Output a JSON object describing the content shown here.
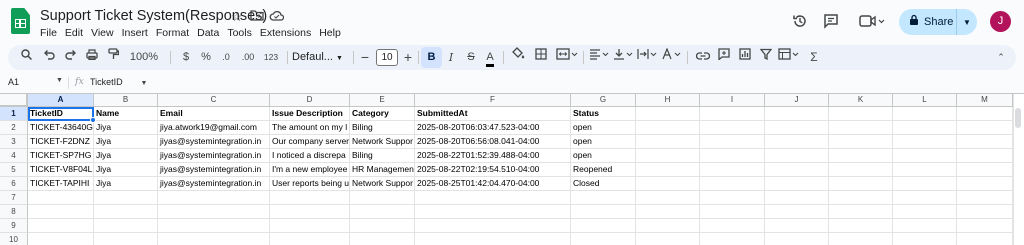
{
  "window": {
    "title": "Support Ticket System(Responses)",
    "menus": [
      "File",
      "Edit",
      "View",
      "Insert",
      "Format",
      "Data",
      "Tools",
      "Extensions",
      "Help"
    ],
    "share_label": "Share",
    "avatar_initial": "J"
  },
  "toolbar": {
    "zoom": "100%",
    "currency_symbol": "$",
    "percent_symbol": "%",
    "decrease_decimal": ".0",
    "increase_decimal": ".00",
    "number_format": "123",
    "font_family": "Defaul...",
    "font_size": "10",
    "bold": "B",
    "italic": "I",
    "text_color": "A"
  },
  "formula_bar": {
    "cell_ref": "A1",
    "fx": "fx",
    "content": "TicketID"
  },
  "sheet": {
    "columns": [
      "A",
      "B",
      "C",
      "D",
      "E",
      "F",
      "G",
      "H",
      "I",
      "J",
      "K",
      "L",
      "M"
    ],
    "row_numbers": [
      "1",
      "2",
      "3",
      "4",
      "5",
      "6",
      "7",
      "8",
      "9",
      "10"
    ],
    "headers": [
      "TicketID",
      "Name",
      "Email",
      "Issue Description",
      "Category",
      "SubmittedAt",
      "Status"
    ],
    "rows": [
      [
        "TICKET-43640G",
        "Jiya",
        "jiya.atwork19@gmail.com",
        "The amount on my l",
        "Biling",
        "2025-08-20T06:03:47.523-04:00",
        "open"
      ],
      [
        "TICKET-F2DNZ",
        "Jiya",
        "jiyas@systemintegration.in",
        "Our company server",
        "Network Suppor",
        "2025-08-20T06:56:08.041-04:00",
        "open"
      ],
      [
        "TICKET-SP7HG",
        "Jiya",
        "jiyas@systemintegration.in",
        "I noticed a discrepa",
        "Biling",
        "2025-08-22T01:52:39.488-04:00",
        "open"
      ],
      [
        "TICKET-V8F04L",
        "Jiya",
        "jiyas@systemintegration.in",
        "I'm a new employee",
        "HR Managemen",
        "2025-08-22T02:19:54.510-04:00",
        "Reopened"
      ],
      [
        "TICKET-TAPIHI",
        "Jiya",
        "jiyas@systemintegration.in",
        "User reports being u",
        "Network Suppor",
        "2025-08-25T01:42:04.470-04:00",
        "Closed"
      ]
    ]
  }
}
